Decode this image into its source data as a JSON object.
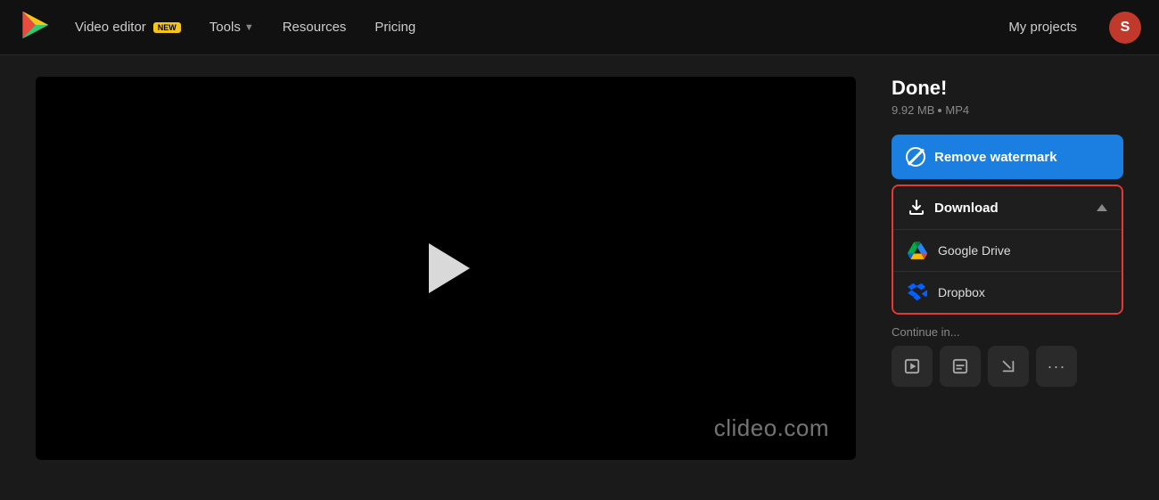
{
  "nav": {
    "logo_alt": "Clideo logo",
    "video_editor_label": "Video editor",
    "badge_label": "NEW",
    "tools_label": "Tools",
    "resources_label": "Resources",
    "pricing_label": "Pricing",
    "my_projects_label": "My projects",
    "avatar_initial": "S"
  },
  "video": {
    "watermark": "clideo.com"
  },
  "panel": {
    "done_title": "Done!",
    "file_size": "9.92 MB",
    "file_format": "MP4",
    "remove_watermark_label": "Remove watermark",
    "download_label": "Download",
    "google_drive_label": "Google Drive",
    "dropbox_label": "Dropbox",
    "continue_label": "Continue in..."
  }
}
